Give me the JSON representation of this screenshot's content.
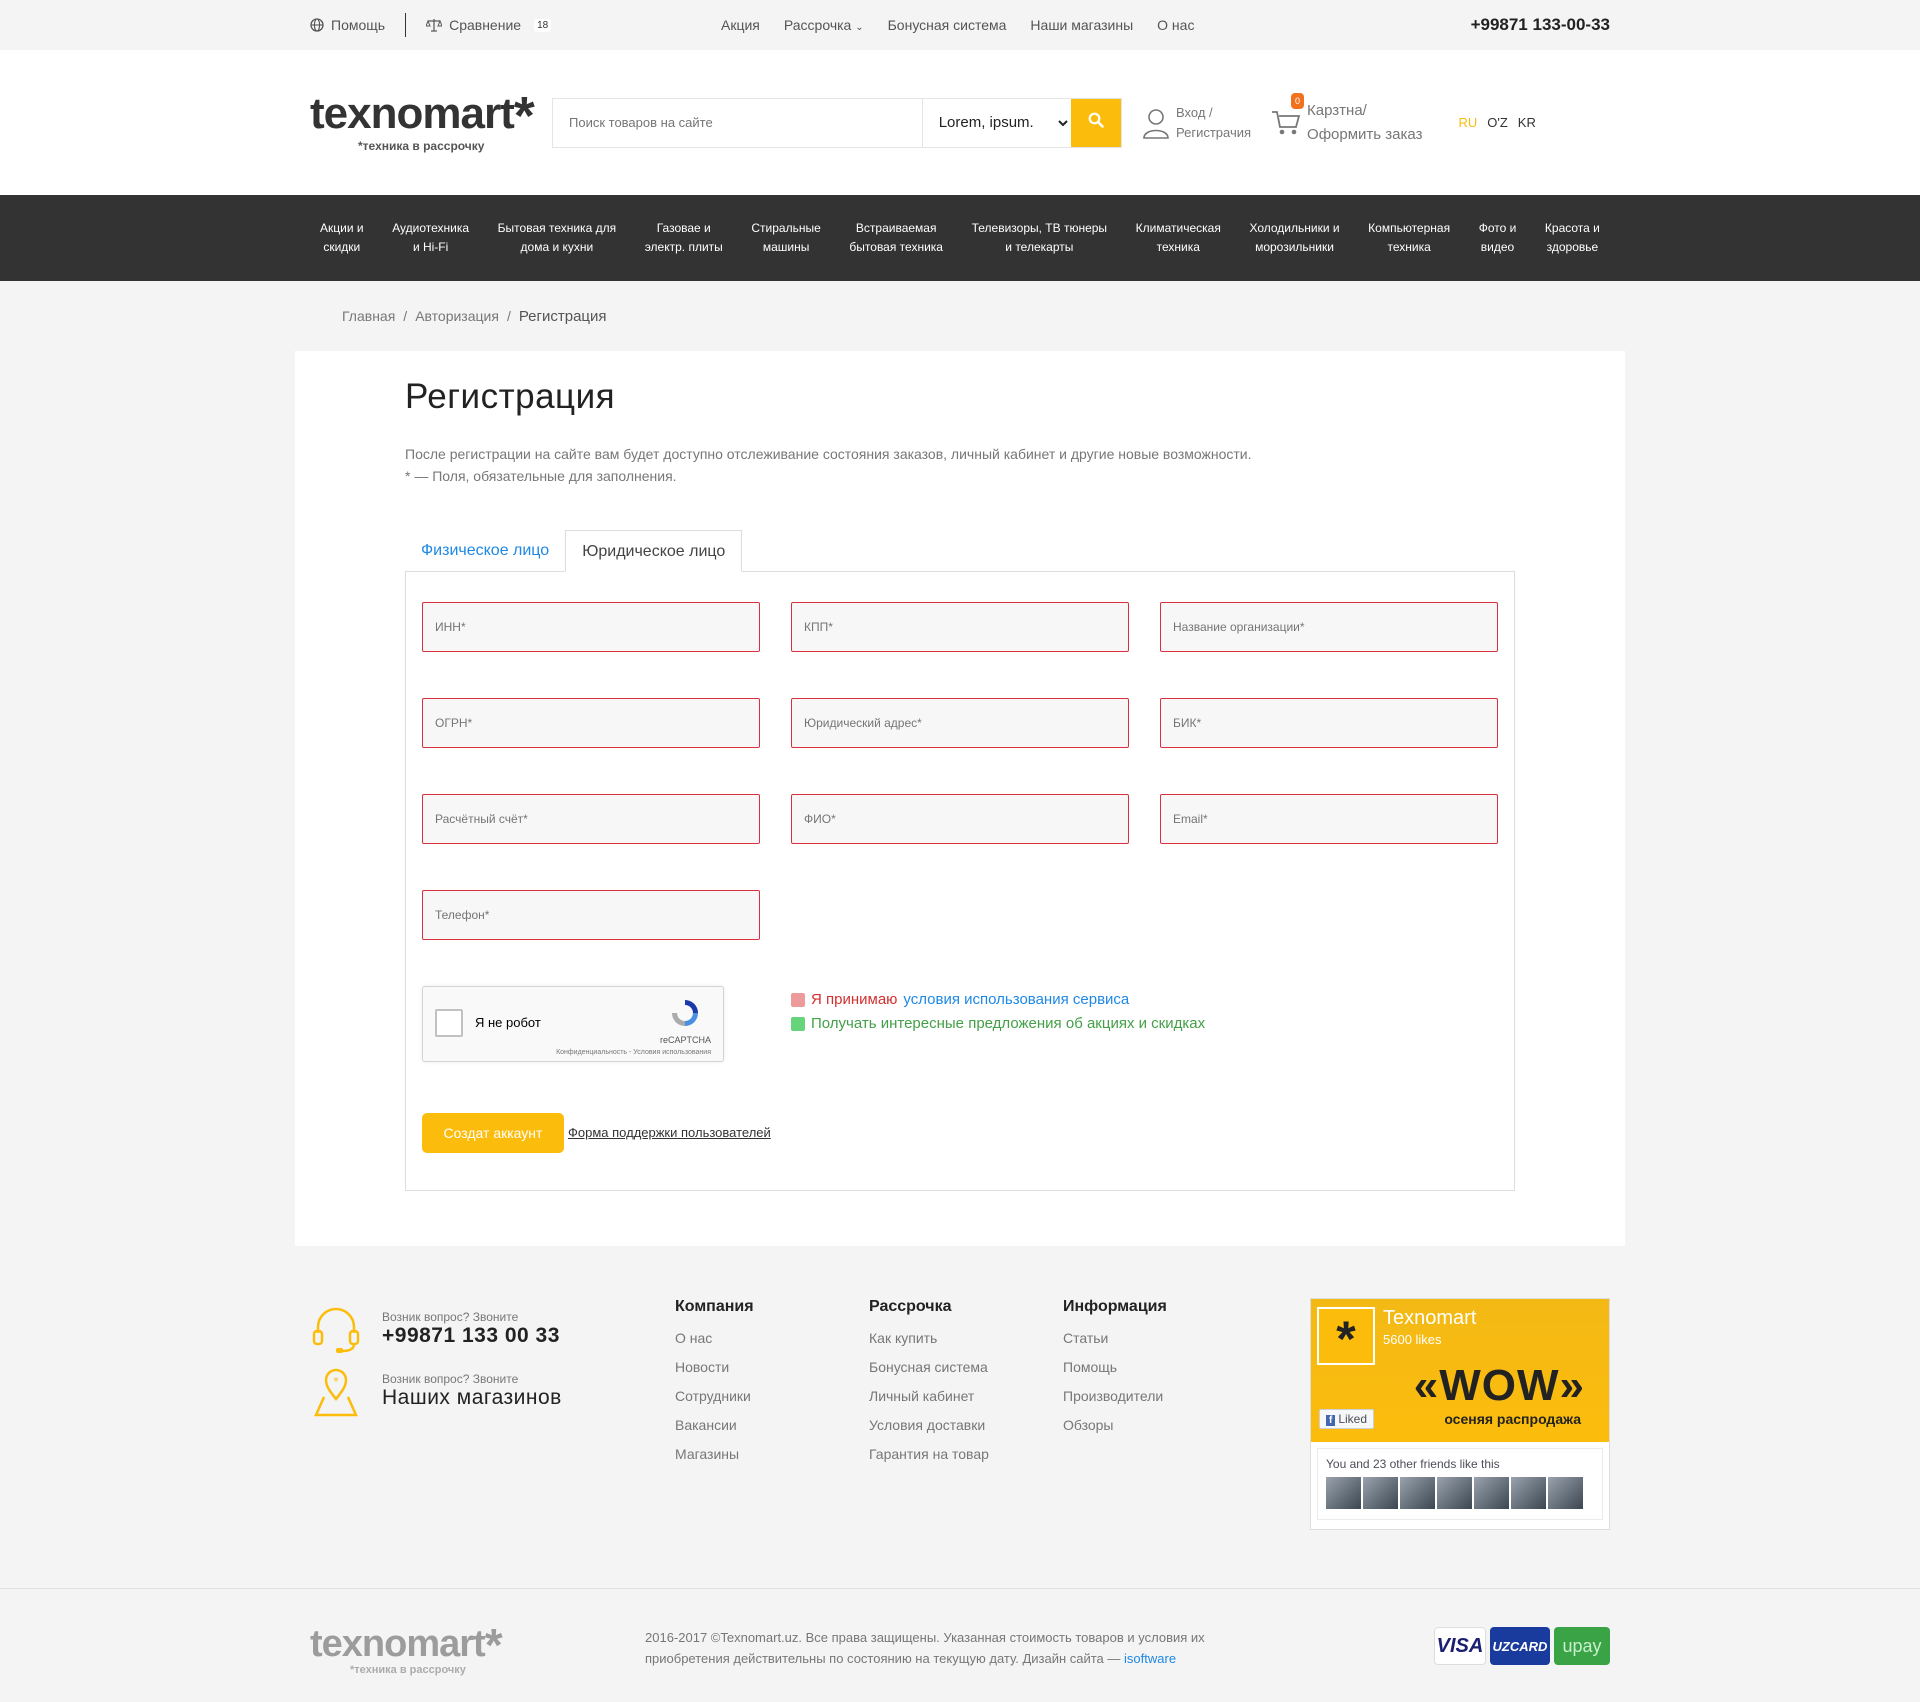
{
  "topbar": {
    "help": "Помощь",
    "compare": "Сравнение",
    "compare_count": "18",
    "links": [
      "Акция",
      "Рассрочка",
      "Бонусная система",
      "Наши магазины",
      "О нас"
    ],
    "phone": "+99871 133-00-33"
  },
  "header": {
    "logo_text": "texnomart",
    "logo_asterisk": "*",
    "logo_tagline": "*техника в рассрочку",
    "search_placeholder": "Поиск товаров на сайте",
    "search_category": "Lorem, ipsum.",
    "login_line1": "Вход /",
    "login_line2": "Регистрачия",
    "cart_count": "0",
    "cart_line1": "Карзтна/",
    "cart_line2": "Оформить заказ",
    "languages": [
      "RU",
      "O'Z",
      "KR"
    ]
  },
  "categories": [
    "Акции и\nскидки",
    "Аудиотехника\nи Hi-Fi",
    "Бытовая техника для\nдома и кухни",
    "Газовае и\nэлектр. плиты",
    "Стиральные\nмашины",
    "Встраиваемая\nбытовая техника",
    "Телевизоры, ТВ тюнеры\nи телекарты",
    "Климатическая\nтехника",
    "Холодильники и\nморозильники",
    "Компьютерная\nтехника",
    "Фото и\nвидео",
    "Красота и\nздоровье"
  ],
  "breadcrumb": [
    "Главная",
    "Авторизация",
    "Регистрация"
  ],
  "page": {
    "title": "Регистрация",
    "intro_line1": "После регистрации на сайте вам будет доступно отслеживание состояния заказов, личный кабинет и другие новые возможности.",
    "intro_line2": "* — Поля, обязательные для заполнения.",
    "tabs": [
      "Физическое лицо",
      "Юридическое лицо"
    ],
    "active_tab": "Юридическое лицо",
    "fields": [
      "ИНН*",
      "КПП*",
      "Название организации*",
      "ОГРН*",
      "Юридический адрес*",
      "БИК*",
      "Расчётный счёт*",
      "ФИО*",
      "Email*",
      "Телефон*"
    ],
    "captcha_label": "Я не робот",
    "captcha_brand": "reCAPTCHA",
    "captcha_links": "Конфиденциальность - Условия использования",
    "agree_text": "Я принимаю",
    "agree_link": "условия использования сервиса",
    "offers_text": "Получать интересные предложения об акциях и скидках",
    "submit": "Создат аккаунт",
    "support_link": "Форма поддержки пользователей"
  },
  "footer": {
    "question1": "Возник вопрос? Звоните",
    "phone": "+99871 133 00 33",
    "question2": "Возник вопрос? Звоните",
    "stores": "Наших магазинов",
    "company": {
      "title": "Компания",
      "items": [
        "О нас",
        "Новости",
        "Сотрудники",
        "Вакансии",
        "Магазины"
      ]
    },
    "installment": {
      "title": "Рассрочка",
      "items": [
        "Как купить",
        "Бонусная система",
        "Личный кабинет",
        "Условия доставки",
        "Гарантия на товар"
      ]
    },
    "info": {
      "title": "Информация",
      "items": [
        "Статьи",
        "Помощь",
        "Производители",
        "Обзоры"
      ]
    },
    "fb": {
      "name": "Texnomart",
      "likes": "5600 likes",
      "wow": "«WOW»",
      "sale": "осеняя распродажа",
      "liked": "Liked",
      "friends": "You and 23 other friends like this"
    },
    "copyright_line1": "2016-2017 ©Texnomart.uz. Все права защищены. Указанная стоимость товаров и условия их",
    "copyright_line2": "приобретения действительны по состоянию на текущую дату. Дизайн сайта —",
    "designer": "isoftware",
    "payments": [
      "VISA",
      "UZCARD",
      "upay"
    ]
  }
}
